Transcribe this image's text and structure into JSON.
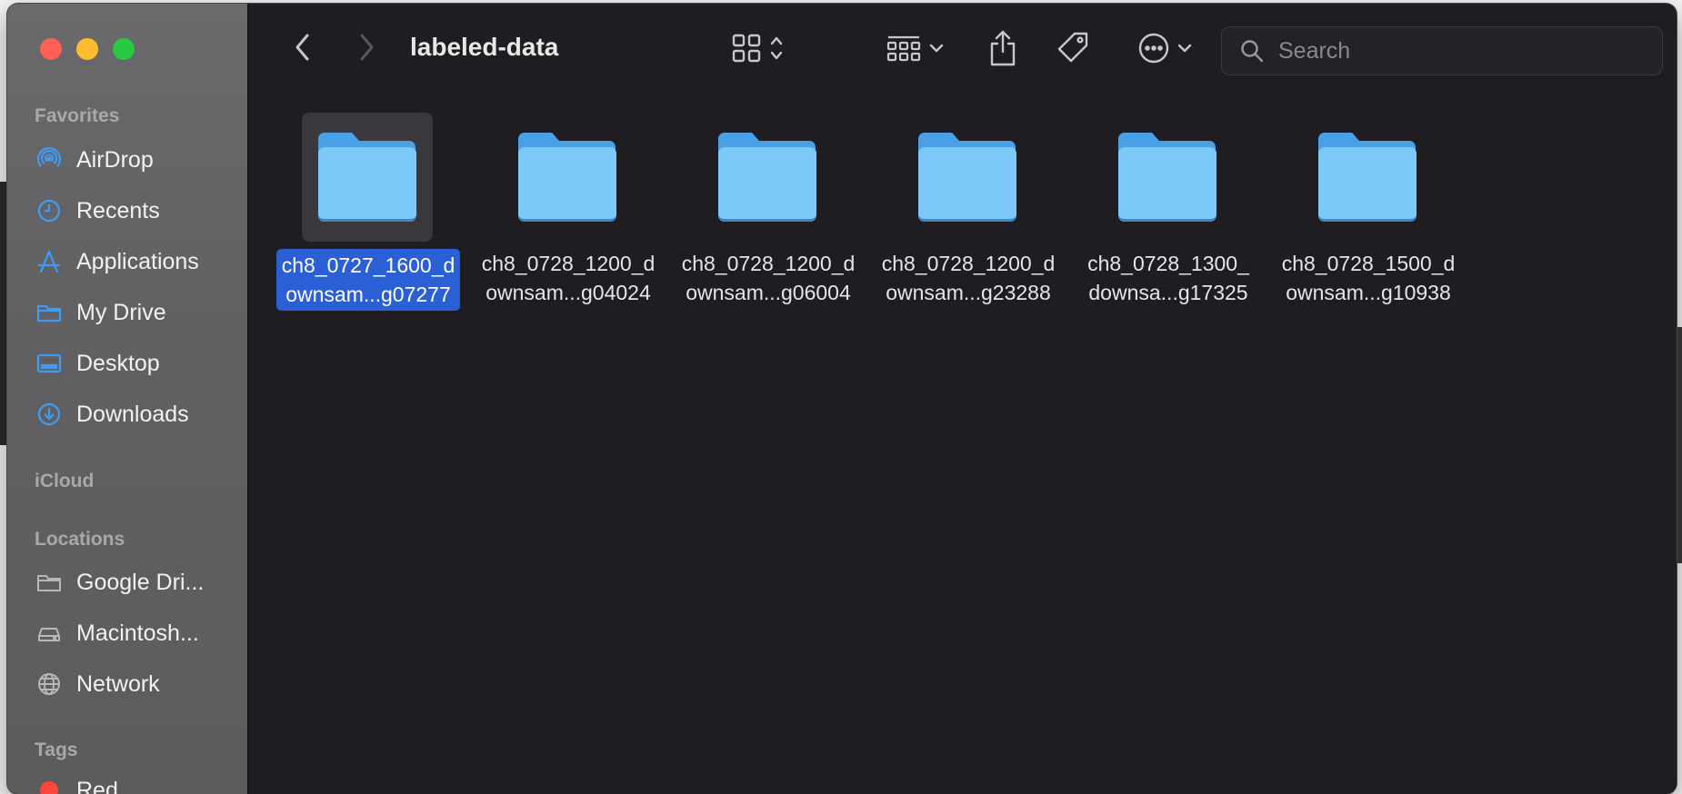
{
  "window": {
    "title": "labeled-data"
  },
  "sidebar": {
    "sections": [
      {
        "label": "Favorites"
      },
      {
        "label": "iCloud"
      },
      {
        "label": "Locations"
      },
      {
        "label": "Tags"
      }
    ],
    "favorites": [
      {
        "label": "AirDrop",
        "icon": "airdrop-icon"
      },
      {
        "label": "Recents",
        "icon": "clock-icon"
      },
      {
        "label": "Applications",
        "icon": "applications-icon"
      },
      {
        "label": "My Drive",
        "icon": "folder-icon"
      },
      {
        "label": "Desktop",
        "icon": "desktop-icon"
      },
      {
        "label": "Downloads",
        "icon": "download-icon"
      }
    ],
    "locations": [
      {
        "label": "Google Dri...",
        "icon": "folder-icon"
      },
      {
        "label": "Macintosh...",
        "icon": "hard-drive-icon"
      },
      {
        "label": "Network",
        "icon": "globe-icon"
      }
    ],
    "tags": [
      {
        "label": "Red",
        "color": "#ff453a"
      }
    ]
  },
  "toolbar": {
    "search_placeholder": "Search"
  },
  "folders": [
    {
      "line1": "ch8_0727_1600_d",
      "line2": "ownsam...g07277",
      "selected": true
    },
    {
      "line1": "ch8_0728_1200_d",
      "line2": "ownsam...g04024",
      "selected": false
    },
    {
      "line1": "ch8_0728_1200_d",
      "line2": "ownsam...g06004",
      "selected": false
    },
    {
      "line1": "ch8_0728_1200_d",
      "line2": "ownsam...g23288",
      "selected": false
    },
    {
      "line1": "ch8_0728_1300_",
      "line2": "downsa...g17325",
      "selected": false
    },
    {
      "line1": "ch8_0728_1500_d",
      "line2": "ownsam...g10938",
      "selected": false
    }
  ],
  "colors": {
    "accent": "#2a5fd6",
    "folder": "#6ab6f0",
    "sidebar_icon": "#3d9cf5"
  }
}
